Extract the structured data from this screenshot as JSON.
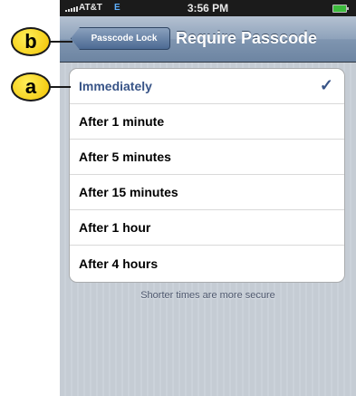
{
  "status_bar": {
    "carrier": "AT&T",
    "network": "E",
    "time": "3:56 PM"
  },
  "nav": {
    "back_label": "Passcode Lock",
    "title": "Require Passcode"
  },
  "options": [
    {
      "label": "Immediately",
      "selected": true
    },
    {
      "label": "After 1 minute",
      "selected": false
    },
    {
      "label": "After 5 minutes",
      "selected": false
    },
    {
      "label": "After 15 minutes",
      "selected": false
    },
    {
      "label": "After 1 hour",
      "selected": false
    },
    {
      "label": "After 4 hours",
      "selected": false
    }
  ],
  "checkmark": "✓",
  "footer_note": "Shorter times are more secure",
  "callouts": {
    "b": "b",
    "a": "a"
  },
  "colors": {
    "accent": "#385487",
    "callout": "#f2c200",
    "nav": "#6d85a2"
  }
}
